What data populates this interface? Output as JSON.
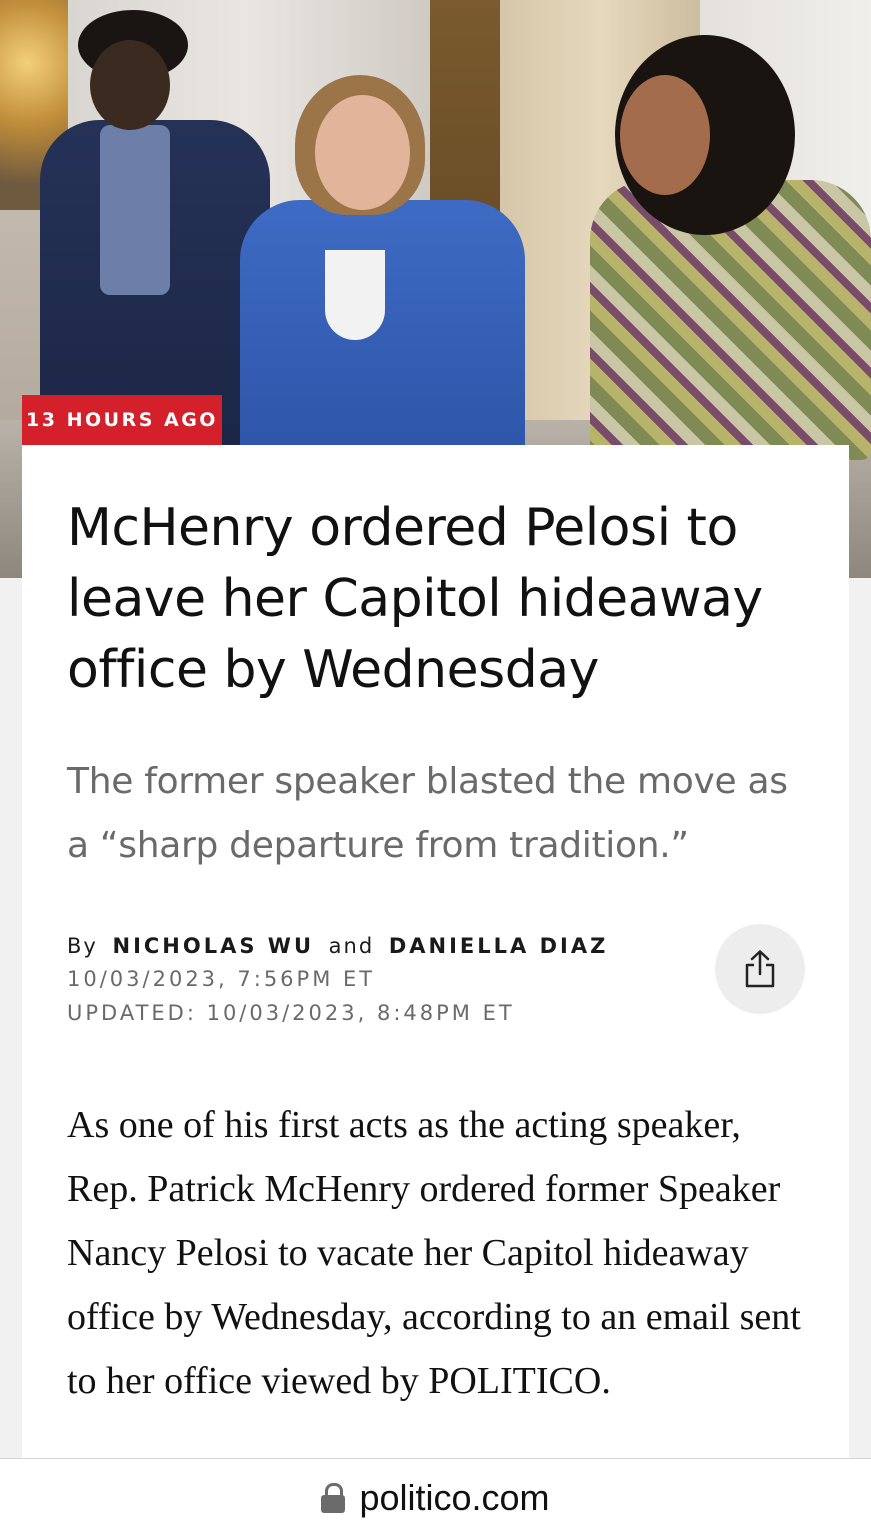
{
  "hero": {
    "timestamp_badge": "13 HOURS AGO",
    "badge_color": "#d4202b"
  },
  "article": {
    "headline": "McHenry ordered Pelosi to leave her Capitol hideaway office by Wednesday",
    "dek": "The former speaker blasted the move as a “sharp departure from tradition.”",
    "byline": {
      "by": "By",
      "author_1": "NICHOLAS WU",
      "and": "and",
      "author_2": "DANIELLA DIAZ"
    },
    "published": "10/03/2023, 7:56PM ET",
    "updated": "UPDATED: 10/03/2023, 8:48PM ET",
    "body_paragraph": "As one of his first acts as the acting speaker, Rep. Patrick McHenry ordered former Speaker Nancy Pelosi to vacate her Capitol hideaway office by Wednesday, according to an email sent to her office viewed by POLITICO."
  },
  "browser": {
    "url": "politico.com",
    "secure_icon": "lock-icon"
  },
  "icons": {
    "share": "share-icon"
  }
}
